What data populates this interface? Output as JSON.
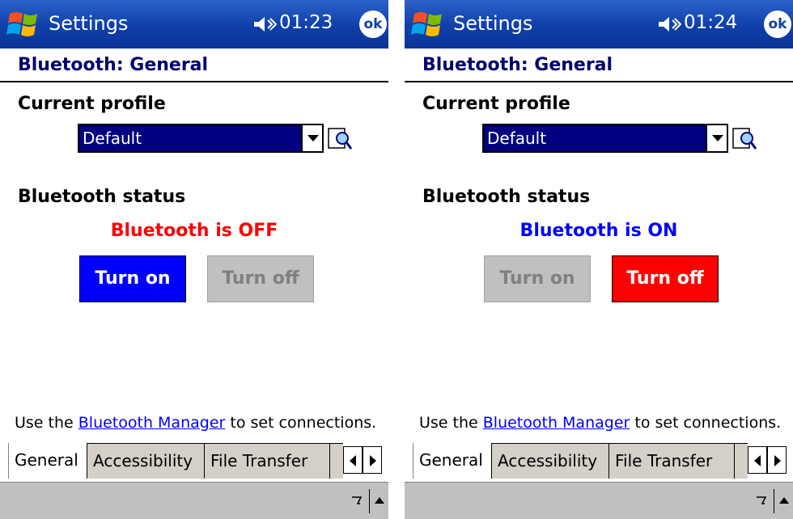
{
  "screens": [
    {
      "title_bar": {
        "app_title": "Settings",
        "time": "01:23",
        "ok_label": "ok"
      },
      "page_title": "Bluetooth: General",
      "profile": {
        "heading": "Current profile",
        "selected": "Default"
      },
      "status": {
        "heading": "Bluetooth status",
        "text": "Bluetooth is OFF",
        "color": "#ff0000"
      },
      "buttons": {
        "turn_on": {
          "label": "Turn on",
          "state": "active"
        },
        "turn_off": {
          "label": "Turn off",
          "state": "disabled"
        }
      },
      "footer": {
        "prefix": "Use the ",
        "link": "Bluetooth Manager",
        "suffix": " to set connections."
      },
      "tabs": [
        "General",
        "Accessibility",
        "File Transfer"
      ],
      "active_tab": "General"
    },
    {
      "title_bar": {
        "app_title": "Settings",
        "time": "01:24",
        "ok_label": "ok"
      },
      "page_title": "Bluetooth: General",
      "profile": {
        "heading": "Current profile",
        "selected": "Default"
      },
      "status": {
        "heading": "Bluetooth status",
        "text": "Bluetooth is ON",
        "color": "#0000ff"
      },
      "buttons": {
        "turn_on": {
          "label": "Turn on",
          "state": "disabled"
        },
        "turn_off": {
          "label": "Turn off",
          "state": "active"
        }
      },
      "footer": {
        "prefix": "Use the ",
        "link": "Bluetooth Manager",
        "suffix": " to set connections."
      },
      "tabs": [
        "General",
        "Accessibility",
        "File Transfer"
      ],
      "active_tab": "General"
    }
  ],
  "colors": {
    "title_bar": "#0f3fa8",
    "header_text": "#00006b",
    "select_bg": "#000080",
    "turn_on_active": "#0000ff",
    "turn_off_active": "#ff0000",
    "disabled_bg": "#c0c0c0",
    "disabled_text": "#808080",
    "link": "#0000ff",
    "menubar": "#c0c0c0"
  },
  "icons": {
    "start": "windows-flag-icon",
    "speaker": "speaker-icon",
    "edit": "profile-edit-icon",
    "sip": "keyboard-input-icon"
  }
}
